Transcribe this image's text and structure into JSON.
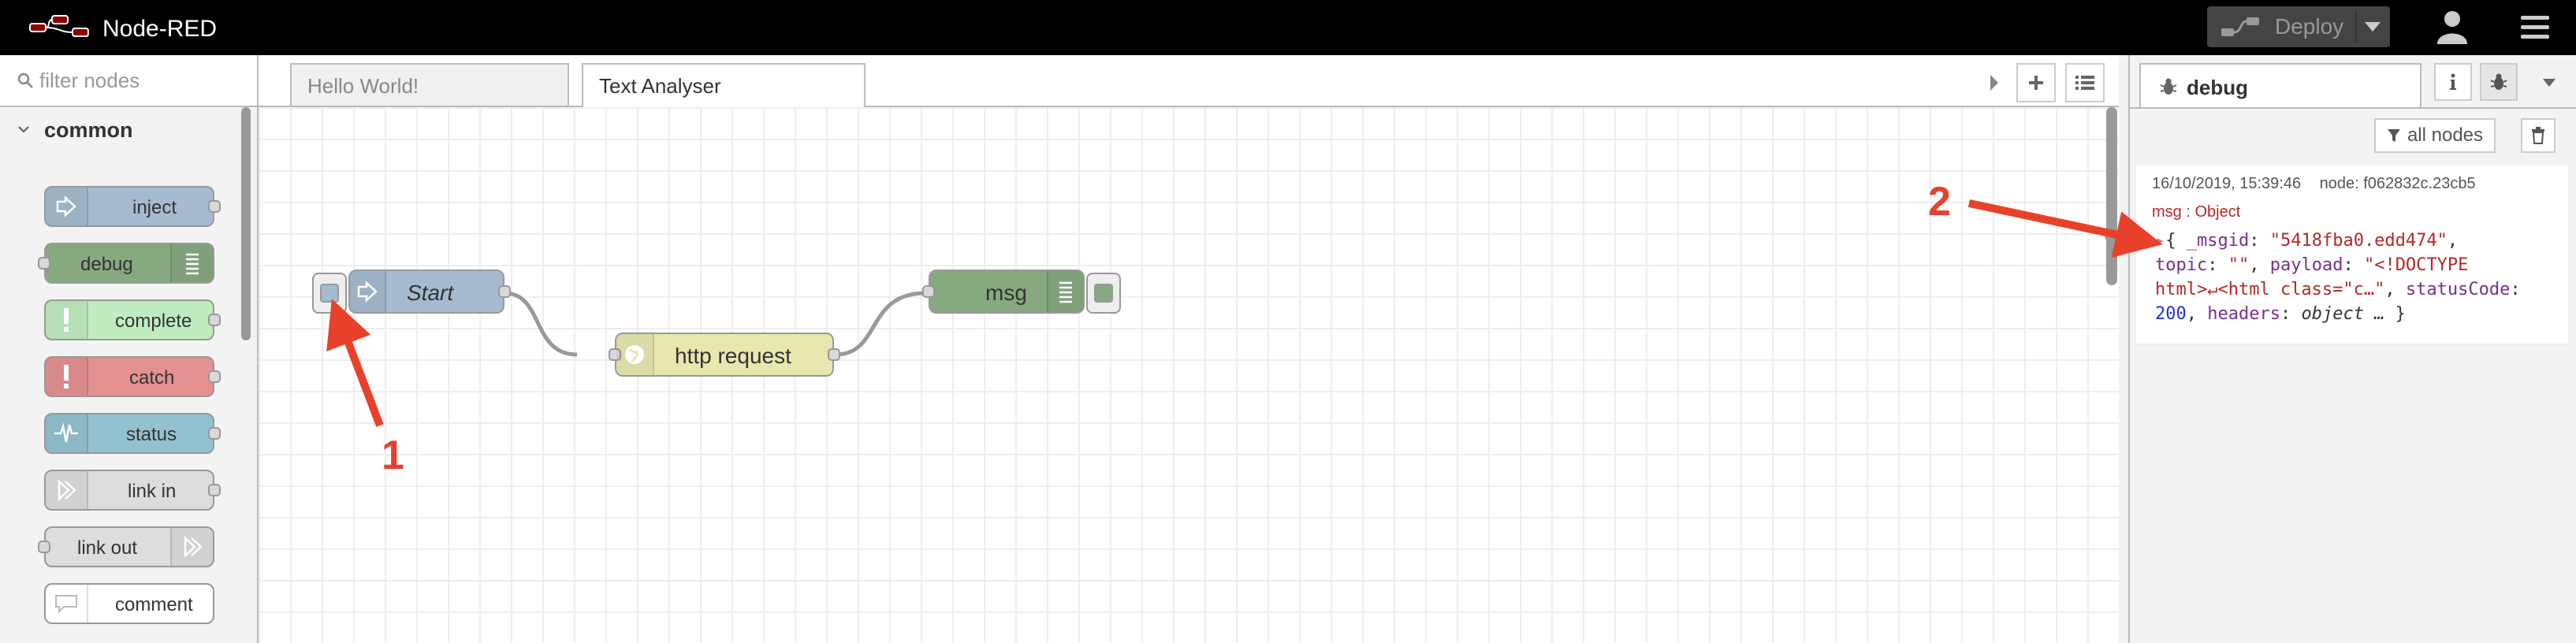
{
  "header": {
    "app_title": "Node-RED",
    "deploy_label": "Deploy",
    "icons": [
      "node-red-logo-icon",
      "deploy-icon",
      "caret-down-icon",
      "user-icon",
      "hamburger-menu-icon"
    ]
  },
  "palette": {
    "search_placeholder": "filter nodes",
    "category": "common",
    "nodes": [
      {
        "label": "inject",
        "color": "#a6bbcf"
      },
      {
        "label": "debug",
        "color": "#87a980"
      },
      {
        "label": "complete",
        "color": "#c0edc0"
      },
      {
        "label": "catch",
        "color": "#e49191"
      },
      {
        "label": "status",
        "color": "#94c1d0"
      },
      {
        "label": "link in",
        "color": "#dddddd"
      },
      {
        "label": "link out",
        "color": "#dddddd"
      },
      {
        "label": "comment",
        "color": "#ffffff"
      }
    ]
  },
  "workspace": {
    "tabs": [
      {
        "label": "Hello World!",
        "active": false
      },
      {
        "label": "Text Analyser",
        "active": true
      }
    ],
    "nodes": [
      {
        "label": "Start",
        "type": "inject",
        "color": "#a6bbcf"
      },
      {
        "label": "http request",
        "type": "http request",
        "color": "#e7e7ae"
      },
      {
        "label": "msg",
        "type": "debug",
        "color": "#87a980"
      }
    ]
  },
  "sidebar": {
    "tab_label": "debug",
    "filter_label": "all nodes",
    "message": {
      "timestamp": "16/10/2019, 15:39:46",
      "node": "node: f062832c.23cb5",
      "type": "msg : Object",
      "msgid_key": "_msgid",
      "msgid_val": "\"5418fba0.edd474\"",
      "topic_key": "topic",
      "topic_val": "\"\"",
      "payload_key": "payload",
      "payload_val_a": "\"<!DOCTYPE",
      "payload_val_b": "html>↵<html class=\"c…\"",
      "status_key": "statusCode",
      "status_val": "200",
      "headers_key": "headers",
      "headers_val": "object …"
    }
  },
  "annotations": {
    "one": "1",
    "two": "2",
    "color": "#e8412a"
  }
}
